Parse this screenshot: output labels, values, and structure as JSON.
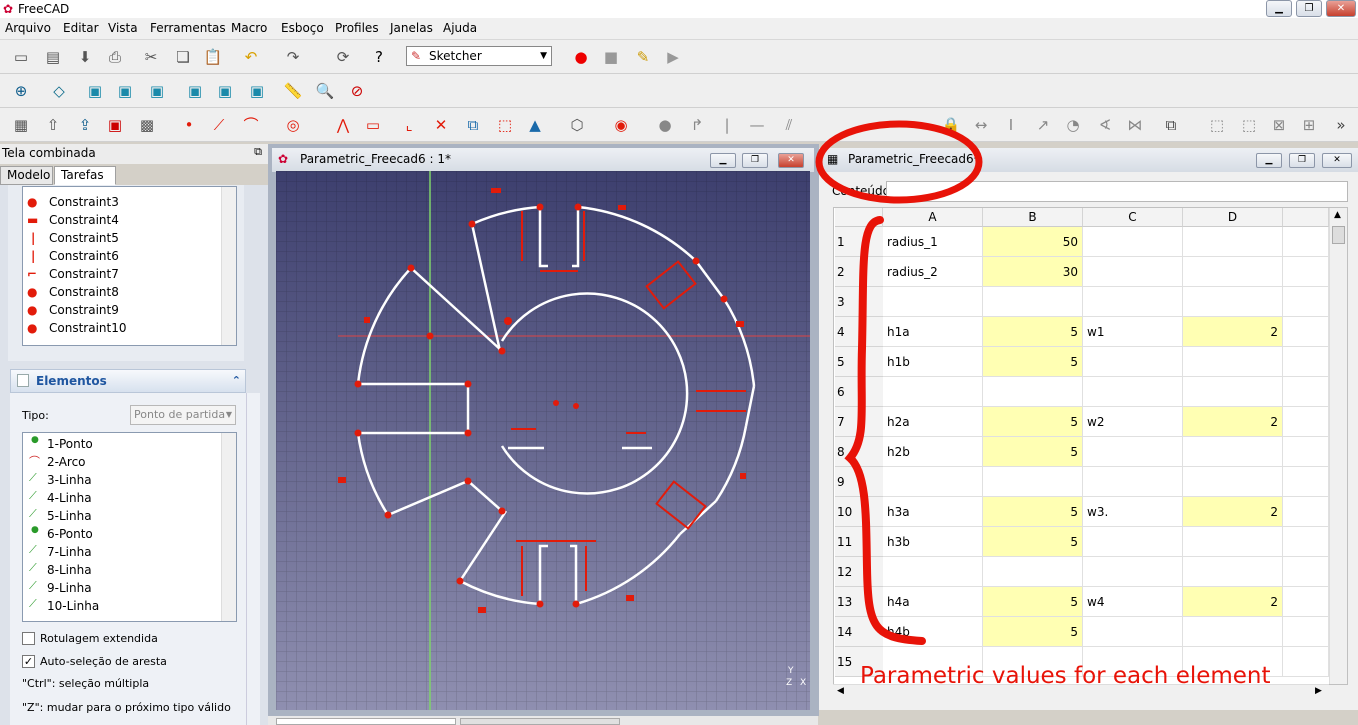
{
  "app": {
    "title": "FreeCAD"
  },
  "menubar": [
    "Arquivo",
    "Editar",
    "Vista",
    "Ferramentas",
    "Macro",
    "Esboço",
    "Profiles",
    "Janelas",
    "Ajuda"
  ],
  "toolbar": {
    "workbench": "Sketcher"
  },
  "combo": {
    "title": "Tela combinada",
    "tabs": [
      "Modelo",
      "Tarefas"
    ],
    "constraints": [
      "Constraint3",
      "Constraint4",
      "Constraint5",
      "Constraint6",
      "Constraint7",
      "Constraint8",
      "Constraint9",
      "Constraint10"
    ],
    "elements_title": "Elementos",
    "type_label": "Tipo:",
    "type_value": "Ponto de partida",
    "elements": [
      "1-Ponto",
      "2-Arco",
      "3-Linha",
      "4-Linha",
      "5-Linha",
      "6-Ponto",
      "7-Linha",
      "8-Linha",
      "9-Linha",
      "10-Linha"
    ],
    "check_extended": "Rotulagem extendida",
    "check_autoselect": "Auto-seleção de aresta",
    "hint_ctrl": "\"Ctrl\": seleção múltipla",
    "hint_z": "\"Z\": mudar para o próximo tipo válido"
  },
  "sketch_window": {
    "title": "Parametric_Freecad6 : 1*"
  },
  "sheet_window": {
    "title": "Parametric_Freecad6*",
    "content_label": "Conteúdo",
    "columns": [
      "A",
      "B",
      "C",
      "D"
    ],
    "rows": [
      {
        "n": "1",
        "a": "radius_1",
        "b": "50",
        "c": "",
        "d": ""
      },
      {
        "n": "2",
        "a": "radius_2",
        "b": "30",
        "c": "",
        "d": ""
      },
      {
        "n": "3",
        "a": "",
        "b": "",
        "c": "",
        "d": ""
      },
      {
        "n": "4",
        "a": "h1a",
        "b": "5",
        "c": "w1",
        "d": "2"
      },
      {
        "n": "5",
        "a": "h1b",
        "b": "5",
        "c": "",
        "d": ""
      },
      {
        "n": "6",
        "a": "",
        "b": "",
        "c": "",
        "d": ""
      },
      {
        "n": "7",
        "a": "h2a",
        "b": "5",
        "c": "w2",
        "d": "2"
      },
      {
        "n": "8",
        "a": "h2b",
        "b": "5",
        "c": "",
        "d": ""
      },
      {
        "n": "9",
        "a": "",
        "b": "",
        "c": "",
        "d": ""
      },
      {
        "n": "10",
        "a": "h3a",
        "b": "5",
        "c": "w3.",
        "d": "2"
      },
      {
        "n": "11",
        "a": "h3b",
        "b": "5",
        "c": "",
        "d": ""
      },
      {
        "n": "12",
        "a": "",
        "b": "",
        "c": "",
        "d": ""
      },
      {
        "n": "13",
        "a": "h4a",
        "b": "5",
        "c": "w4",
        "d": "2"
      },
      {
        "n": "14",
        "a": "h4b",
        "b": "5",
        "c": "",
        "d": ""
      },
      {
        "n": "15",
        "a": "",
        "b": "",
        "c": "",
        "d": ""
      }
    ]
  },
  "annotation": "Parametric values for each element",
  "colors": {
    "accent_red": "#e81308",
    "yellow_cell": "#ffffb3",
    "sketch_bg": "#4a4c7c"
  }
}
